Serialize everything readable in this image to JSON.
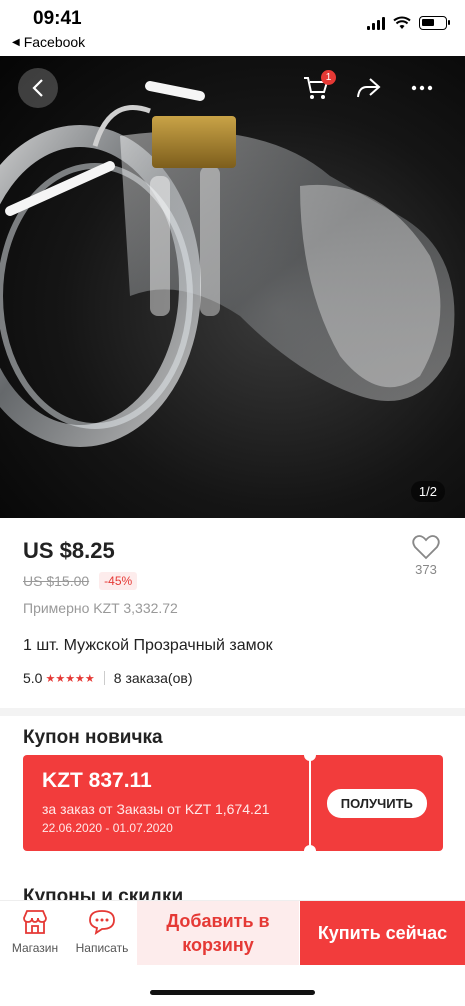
{
  "status_bar": {
    "time": "09:41",
    "back_app": "Facebook"
  },
  "product": {
    "image_counter": "1/2",
    "cart_badge": "1",
    "price": "US $8.25",
    "old_price": "US $15.00",
    "discount": "-45%",
    "approx_price": "Примерно KZT 3,332.72",
    "wishlist_count": "373",
    "title": "1 шт. Мужской Прозрачный замок",
    "rating": "5.0",
    "stars": "★★★★★",
    "orders": "8 заказа(ов)"
  },
  "coupon": {
    "heading": "Купон новичка",
    "amount": "KZT 837.11",
    "condition": "за заказ от Заказы от KZT 1,674.21",
    "dates": "22.06.2020 - 01.07.2020",
    "get_label": "ПОЛУЧИТЬ"
  },
  "next_section": "Купоны и скидки",
  "bottom_bar": {
    "store_label": "Магазин",
    "chat_label": "Написать",
    "add_to_cart": "Добавить в корзину",
    "buy_now": "Купить сейчас"
  },
  "colors": {
    "accent": "#f23c3c",
    "accent_light": "#fdecec",
    "price_text": "#222222"
  }
}
